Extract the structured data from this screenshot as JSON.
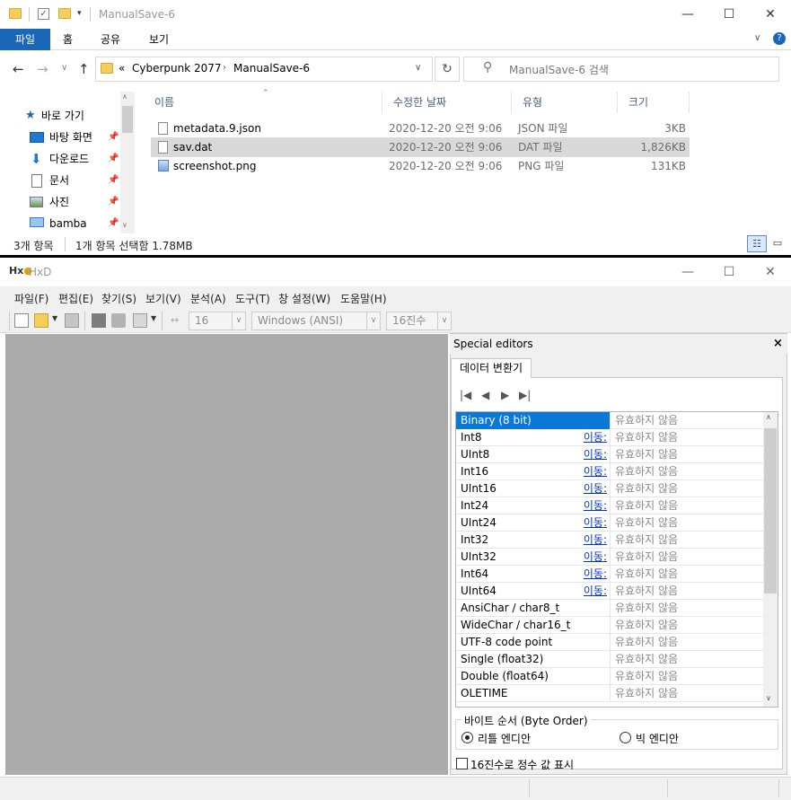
{
  "explorer": {
    "title": "ManualSave-6",
    "ribbon_tabs": [
      "파일",
      "홈",
      "공유",
      "보기"
    ],
    "breadcrumb": {
      "prefix": "«",
      "items": [
        "Cyberpunk 2077",
        "ManualSave-6"
      ]
    },
    "search_placeholder": "ManualSave-6 검색",
    "nav": {
      "quick_access": "바로 가기",
      "items": [
        {
          "label": "바탕 화면",
          "icon": "desktop-icon"
        },
        {
          "label": "다운로드",
          "icon": "download-icon"
        },
        {
          "label": "문서",
          "icon": "document-icon"
        },
        {
          "label": "사진",
          "icon": "picture-icon"
        },
        {
          "label": "bamba",
          "icon": "monitor-icon"
        }
      ]
    },
    "columns": [
      "이름",
      "수정한 날짜",
      "유형",
      "크기"
    ],
    "files": [
      {
        "name": "metadata.9.json",
        "date": "2020-12-20 오전 9:06",
        "type": "JSON 파일",
        "size": "3KB",
        "selected": false
      },
      {
        "name": "sav.dat",
        "date": "2020-12-20 오전 9:06",
        "type": "DAT 파일",
        "size": "1,826KB",
        "selected": true
      },
      {
        "name": "screenshot.png",
        "date": "2020-12-20 오전 9:06",
        "type": "PNG 파일",
        "size": "131KB",
        "selected": false
      }
    ],
    "status": {
      "count": "3개 항목",
      "selection": "1개 항목 선택함 1.78MB"
    }
  },
  "hxd": {
    "title": "HxD",
    "menu": [
      "파일(F)",
      "편집(E)",
      "찾기(S)",
      "보기(V)",
      "분석(A)",
      "도구(T)",
      "창 설정(W)",
      "도움말(H)"
    ],
    "toolbar": {
      "bytes_per_row": "16",
      "charset": "Windows (ANSI)",
      "offset_base": "16진수"
    },
    "special_editors": {
      "title": "Special editors",
      "close": "×",
      "tab": "데이터 변환기",
      "rows": [
        {
          "name": "Binary (8 bit)",
          "link": "",
          "value": "유효하지 않음",
          "selected": true
        },
        {
          "name": "Int8",
          "link": "이동:",
          "value": "유효하지 않음"
        },
        {
          "name": "UInt8",
          "link": "이동:",
          "value": "유효하지 않음"
        },
        {
          "name": "Int16",
          "link": "이동:",
          "value": "유효하지 않음"
        },
        {
          "name": "UInt16",
          "link": "이동:",
          "value": "유효하지 않음"
        },
        {
          "name": "Int24",
          "link": "이동:",
          "value": "유효하지 않음"
        },
        {
          "name": "UInt24",
          "link": "이동:",
          "value": "유효하지 않음"
        },
        {
          "name": "Int32",
          "link": "이동:",
          "value": "유효하지 않음"
        },
        {
          "name": "UInt32",
          "link": "이동:",
          "value": "유효하지 않음"
        },
        {
          "name": "Int64",
          "link": "이동:",
          "value": "유효하지 않음"
        },
        {
          "name": "UInt64",
          "link": "이동:",
          "value": "유효하지 않음"
        },
        {
          "name": "AnsiChar / char8_t",
          "link": "",
          "value": "유효하지 않음"
        },
        {
          "name": "WideChar / char16_t",
          "link": "",
          "value": "유효하지 않음"
        },
        {
          "name": "UTF-8 code point",
          "link": "",
          "value": "유효하지 않음"
        },
        {
          "name": "Single (float32)",
          "link": "",
          "value": "유효하지 않음"
        },
        {
          "name": "Double (float64)",
          "link": "",
          "value": "유효하지 않음"
        },
        {
          "name": "OLETIME",
          "link": "",
          "value": "유효하지 않음"
        }
      ],
      "byte_order": {
        "title": "바이트 순서 (Byte Order)",
        "little": "리틀 엔디안",
        "big": "빅 엔디안",
        "selected": "little"
      },
      "hex_checkbox": "16진수로 정수 값 표시"
    }
  }
}
